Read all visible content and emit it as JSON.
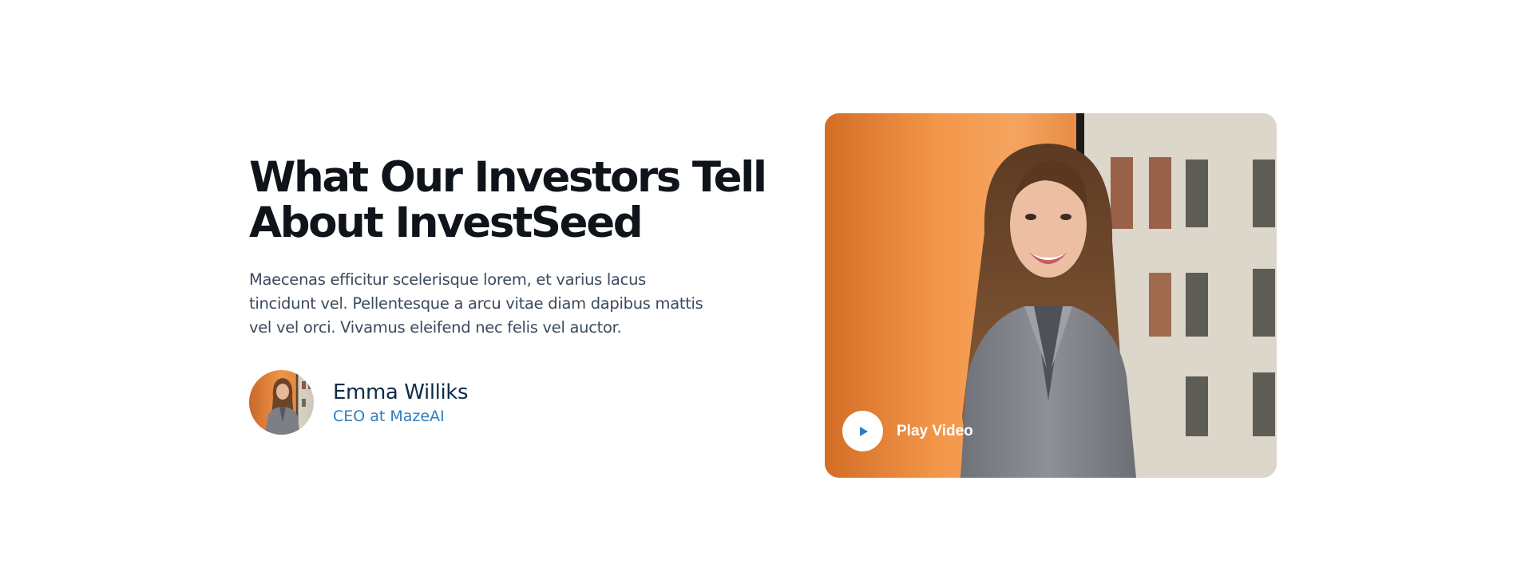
{
  "testimonial": {
    "heading": [
      "What Our Investors Tell",
      "About InvestSeed"
    ],
    "description": [
      "Maecenas efficitur scelerisque lorem, et varius lacus",
      "tincidunt vel. Pellentesque a arcu vitae diam dapibus mattis",
      "vel vel orci. Vivamus eleifend nec felis vel auctor."
    ],
    "author": {
      "name": "Emma Williks",
      "role": "CEO at MazeAI"
    }
  },
  "video": {
    "play_label": "Play Video"
  },
  "colors": {
    "heading": "#0f141a",
    "body_text": "#3b4a5c",
    "author_name": "#0d2b4b",
    "accent_blue": "#2f7dbf",
    "photo_orange": "#ec8a3d"
  },
  "icons": {
    "play": "play-icon"
  }
}
